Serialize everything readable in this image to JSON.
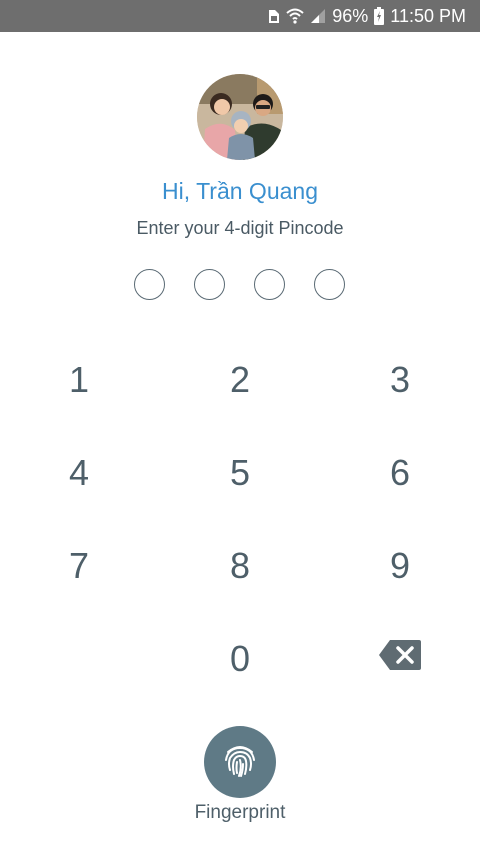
{
  "status_bar": {
    "battery_percent": "96%",
    "time": "11:50 PM",
    "icons": [
      "sim-card-icon",
      "wifi-icon",
      "signal-icon",
      "battery-icon"
    ]
  },
  "profile": {
    "greeting": "Hi, Trần Quang",
    "avatar_icon": "family-photo-avatar"
  },
  "pin": {
    "instruction": "Enter your 4-digit Pincode",
    "length": 4,
    "entered": 0
  },
  "keypad": {
    "keys": [
      "1",
      "2",
      "3",
      "4",
      "5",
      "6",
      "7",
      "8",
      "9",
      "0"
    ],
    "backspace_icon": "backspace-icon"
  },
  "fingerprint": {
    "label": "Fingerprint",
    "icon": "fingerprint-icon"
  },
  "colors": {
    "status_bar_bg": "#6e6e6e",
    "greeting": "#3a8fcf",
    "text": "#4e5f69",
    "fingerprint_bg": "#5f7a86"
  }
}
